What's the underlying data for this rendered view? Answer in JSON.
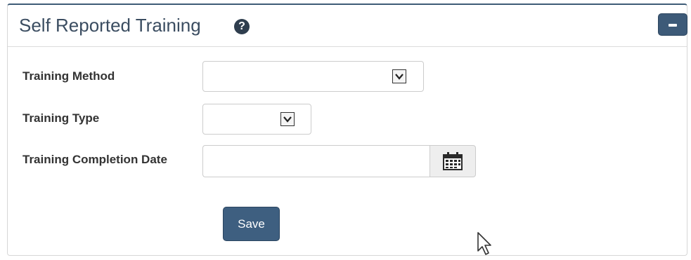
{
  "panel": {
    "title": "Self Reported Training",
    "help_icon": "question-circle-icon",
    "collapse_icon": "minus-icon"
  },
  "form": {
    "training_method": {
      "label": "Training Method",
      "value": "",
      "icon": "chevron-down-icon"
    },
    "training_type": {
      "label": "Training Type",
      "value": "",
      "icon": "chevron-down-icon"
    },
    "completion_date": {
      "label": "Training Completion Date",
      "value": "",
      "placeholder": "",
      "icon": "calendar-icon"
    },
    "save_label": "Save"
  },
  "colors": {
    "title_text": "#3b4d61",
    "primary_button": "#3e5f80",
    "panel_top_border": "#3e5b77"
  }
}
